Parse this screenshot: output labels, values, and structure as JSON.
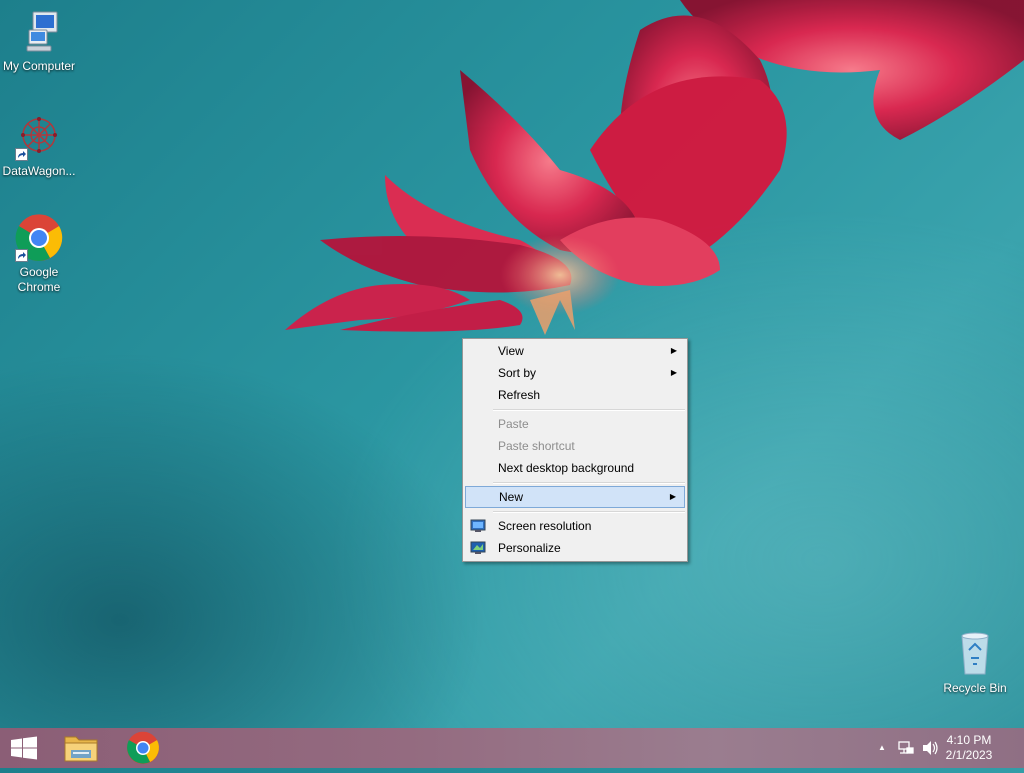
{
  "desktop": {
    "icons": [
      {
        "label": "My Computer",
        "icon": "computer-icon"
      },
      {
        "label": "DataWagon...",
        "icon": "datawagon-icon"
      },
      {
        "label": "Google Chrome",
        "icon": "chrome-icon"
      },
      {
        "label": "Recycle Bin",
        "icon": "recycle-bin-icon"
      }
    ]
  },
  "context_menu": {
    "items": [
      {
        "label": "View",
        "submenu": true,
        "enabled": true
      },
      {
        "label": "Sort by",
        "submenu": true,
        "enabled": true
      },
      {
        "label": "Refresh",
        "submenu": false,
        "enabled": true
      },
      {
        "label": "Paste",
        "submenu": false,
        "enabled": false
      },
      {
        "label": "Paste shortcut",
        "submenu": false,
        "enabled": false
      },
      {
        "label": "Next desktop background",
        "submenu": false,
        "enabled": true
      },
      {
        "label": "New",
        "submenu": true,
        "enabled": true,
        "highlighted": true
      },
      {
        "label": "Screen resolution",
        "submenu": false,
        "enabled": true,
        "icon": "display-icon"
      },
      {
        "label": "Personalize",
        "submenu": false,
        "enabled": true,
        "icon": "personalize-icon"
      }
    ],
    "submenu_arrow": "▶"
  },
  "taskbar": {
    "start": {
      "icon": "windows-logo-icon"
    },
    "pinned": [
      {
        "icon": "file-explorer-icon"
      },
      {
        "icon": "chrome-icon"
      }
    ],
    "tray": {
      "show_hidden_arrow": "▲",
      "network_icon": "network-icon",
      "volume_icon": "volume-icon"
    },
    "clock": {
      "time": "4:10 PM",
      "date": "2/1/2023"
    }
  },
  "colors": {
    "menu_highlight": "#d1e3f8",
    "taskbar": "#946b80",
    "desktop": "#2b97a2"
  }
}
